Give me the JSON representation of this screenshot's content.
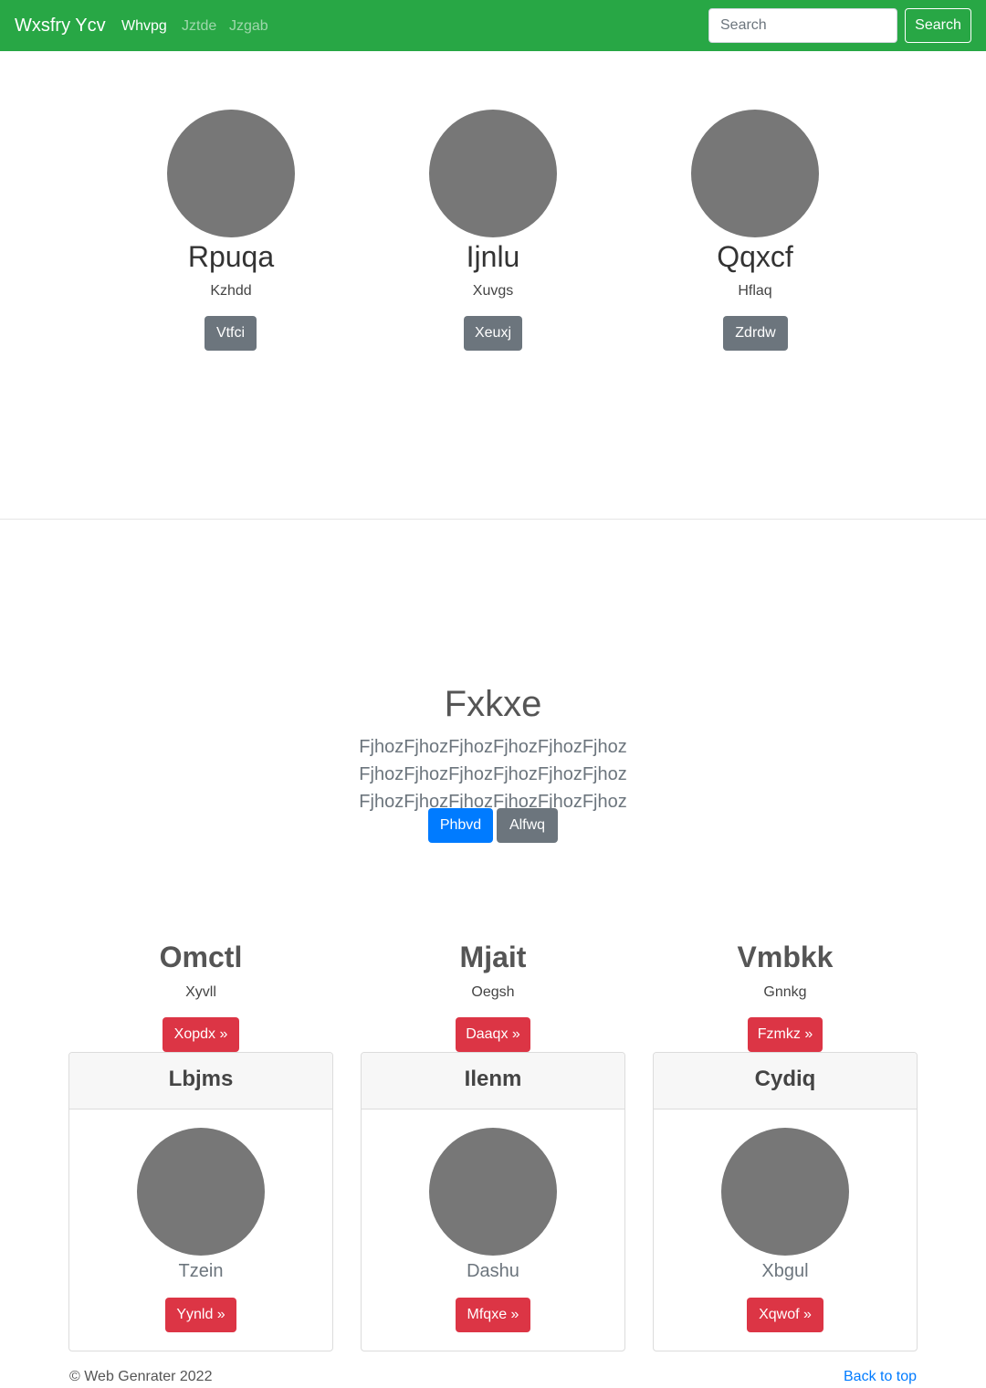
{
  "nav": {
    "brand": "Wxsfry Ycv",
    "links": [
      "Whvpg",
      "Jztde",
      "Jzgab"
    ],
    "search_placeholder": "Search",
    "search_button": "Search"
  },
  "people": [
    {
      "name": "Rpuqa",
      "subtitle": "Kzhdd",
      "button": "Vtfci"
    },
    {
      "name": "Ijnlu",
      "subtitle": "Xuvgs",
      "button": "Xeuxj"
    },
    {
      "name": "Qqxcf",
      "subtitle": "Hflaq",
      "button": "Zdrdw"
    }
  ],
  "hero": {
    "title": "Fxkxe",
    "lead": "FjhozFjhozFjhozFjhozFjhozFjhoz FjhozFjhozFjhozFjhozFjhozFjhoz FjhozFjhozFjhozFjhozFjhozFjhoz",
    "primary_button": "Phbvd",
    "secondary_button": "Alfwq"
  },
  "columns": [
    {
      "title": "Omctl",
      "subtitle": "Xyvll",
      "button": "Xopdx »"
    },
    {
      "title": "Mjait",
      "subtitle": "Oegsh",
      "button": "Daaqx »"
    },
    {
      "title": "Vmbkk",
      "subtitle": "Gnnkg",
      "button": "Fzmkz »"
    }
  ],
  "cards": [
    {
      "header": "Lbjms",
      "text": "Tzein",
      "button": "Yynld »"
    },
    {
      "header": "Ilenm",
      "text": "Dashu",
      "button": "Mfqxe »"
    },
    {
      "header": "Cydiq",
      "text": "Xbgul",
      "button": "Xqwof »"
    }
  ],
  "footer": {
    "copyright": "© Web Genrater 2022",
    "back_to_top": "Back to top"
  },
  "colors": {
    "navbar": "#28a745",
    "primary": "#007bff",
    "secondary": "#6c757d",
    "danger": "#dc3545",
    "avatar": "#777777"
  }
}
